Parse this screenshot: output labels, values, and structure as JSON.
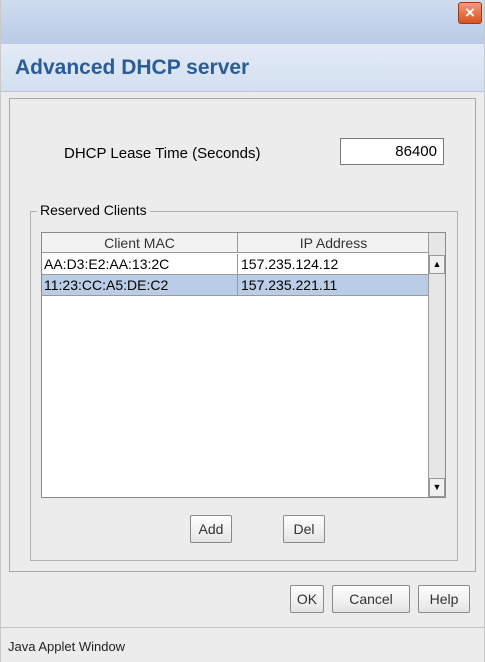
{
  "window": {
    "close_icon": "×",
    "header_title": "Advanced DHCP server"
  },
  "lease": {
    "label": "DHCP Lease Time (Seconds)",
    "value": "86400"
  },
  "reserved_clients": {
    "legend": "Reserved Clients",
    "columns": [
      "Client MAC",
      "IP Address"
    ],
    "rows": [
      {
        "mac": "AA:D3:E2:AA:13:2C",
        "ip": "157.235.124.12",
        "selected": false
      },
      {
        "mac": "11:23:CC:A5:DE:C2",
        "ip": "157.235.221.11",
        "selected": true
      }
    ],
    "add_label": "Add",
    "del_label": "Del"
  },
  "dialog_buttons": {
    "ok_label": "OK",
    "cancel_label": "Cancel",
    "help_label": "Help"
  },
  "status": {
    "text": "Java Applet Window"
  },
  "icons": {
    "close": "close-icon",
    "scroll_up": "arrow-up-icon",
    "scroll_down": "arrow-down-icon"
  },
  "colors": {
    "header_title": "#2a5d97",
    "selected_row": "#b9cde6",
    "close_button": "#d8531f"
  }
}
